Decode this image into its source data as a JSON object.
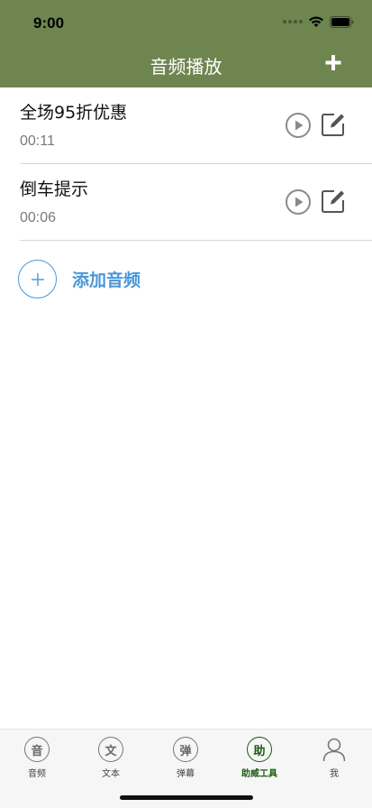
{
  "status": {
    "time": "9:00"
  },
  "header": {
    "title": "音频播放",
    "add_icon": "plus-icon"
  },
  "audio_items": [
    {
      "name": "全场95折优惠",
      "duration": "00:11"
    },
    {
      "name": "倒车提示",
      "duration": "00:06"
    }
  ],
  "add_audio": {
    "label": "添加音频",
    "icon": "plus"
  },
  "tabs": [
    {
      "glyph": "音",
      "label": "音频",
      "active": false
    },
    {
      "glyph": "文",
      "label": "文本",
      "active": false
    },
    {
      "glyph": "弹",
      "label": "弹幕",
      "active": false
    },
    {
      "glyph": "助",
      "label": "助威工具",
      "active": true
    },
    {
      "glyph": "",
      "label": "我",
      "active": false
    }
  ],
  "colors": {
    "header": "#6e8550",
    "accent": "#4a97d8",
    "active_tab": "#1f5a12"
  }
}
